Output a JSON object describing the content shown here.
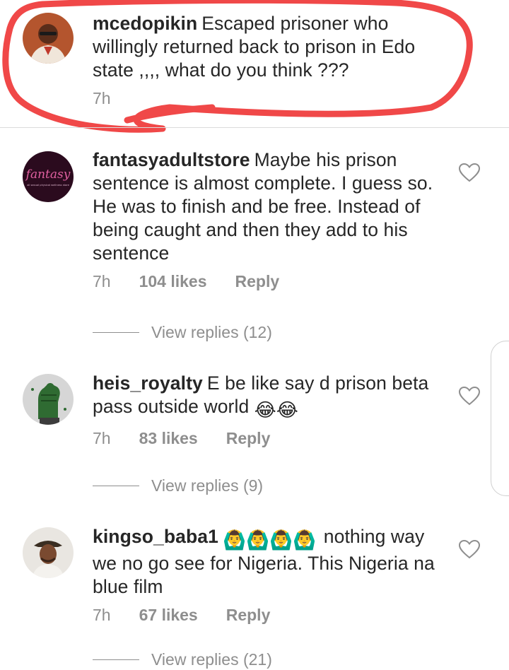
{
  "caption": {
    "username": "mcedopikin",
    "text": "Escaped prisoner who willingly returned back to prison in Edo state ,,,, what do you think ???",
    "time": "7h"
  },
  "comments": [
    {
      "username": "fantasyadultstore",
      "text": "Maybe his prison sentence is almost complete. I guess so. He was to finish and be free. Instead of being caught and then they add to his sentence",
      "time": "7h",
      "likes": "104 likes",
      "reply_label": "Reply",
      "view_replies": "View replies (12)",
      "avatar_text": "fantasy",
      "avatar_subtext": "all sexual physical wellness store"
    },
    {
      "username": "heis_royalty",
      "text": "E be like say d prison beta pass outside world",
      "emoji": "😂😂",
      "time": "7h",
      "likes": "83 likes",
      "reply_label": "Reply",
      "view_replies": "View replies (9)"
    },
    {
      "username": "kingso_baba1",
      "emoji": "🙆‍♂️🙆‍♂️🙆‍♂️🙆‍♂️",
      "text": "nothing way we no go see for Nigeria.  This Nigeria na blue film",
      "time": "7h",
      "likes": "67 likes",
      "reply_label": "Reply",
      "view_replies": "View replies (21)"
    }
  ],
  "icons": {
    "like": "heart-outline-icon"
  },
  "colors": {
    "text": "#262626",
    "muted": "#8e8e8e",
    "annotation": "#f04848"
  }
}
